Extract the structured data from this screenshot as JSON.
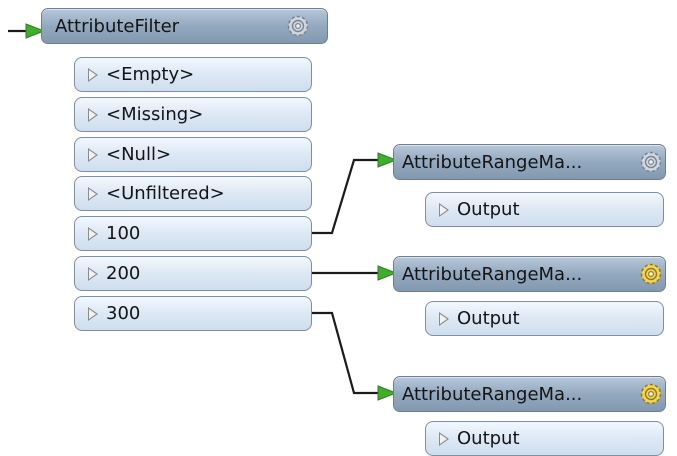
{
  "colors": {
    "connected_port": "#3fae2a",
    "unconnected_port": "#f2c21b",
    "wire": "#1b1b1b",
    "gear_active": "#f5d54a",
    "gear_inactive": "#cfd6de"
  },
  "filter": {
    "title": "AttributeFilter",
    "icon": "gear-icon",
    "ports": [
      {
        "label": "<Empty>",
        "connected": false
      },
      {
        "label": "<Missing>",
        "connected": false
      },
      {
        "label": "<Null>",
        "connected": false
      },
      {
        "label": "<Unfiltered>",
        "connected": false
      },
      {
        "label": "100",
        "connected": true
      },
      {
        "label": "200",
        "connected": true
      },
      {
        "label": "300",
        "connected": true
      }
    ]
  },
  "mappers": [
    {
      "title": "AttributeRangeMa...",
      "icon": "gear-icon",
      "gear_state": "inactive",
      "output_label": "Output"
    },
    {
      "title": "AttributeRangeMa...",
      "icon": "gear-icon",
      "gear_state": "active",
      "output_label": "Output"
    },
    {
      "title": "AttributeRangeMa...",
      "icon": "gear-icon",
      "gear_state": "active",
      "output_label": "Output"
    }
  ]
}
